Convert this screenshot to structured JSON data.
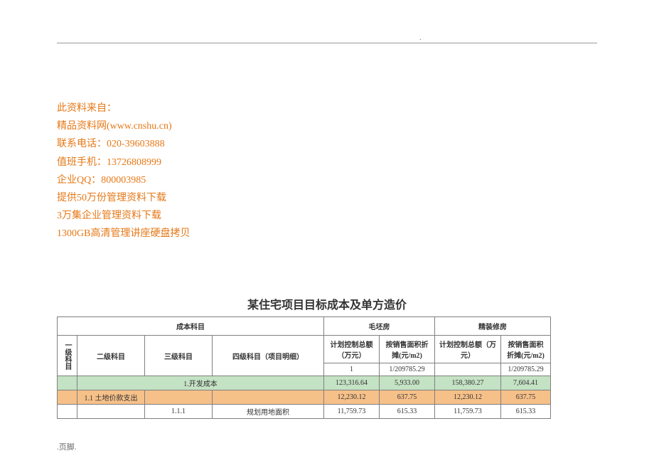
{
  "dot": ".",
  "source": {
    "line1": "此资料来自：",
    "line2": "精品资料网(www.cnshu.cn)",
    "line3": "联系电话：020-39603888",
    "line4": "值班手机：13726808999",
    "line5": "企业QQ：800003985",
    "line6": "提供50万份管理资料下载",
    "line7": "3万集企业管理资料下载",
    "line8": "1300GB高清管理讲座硬盘拷贝"
  },
  "title": "某住宅项目目标成本及单方造价",
  "headers": {
    "cost_subject": "成本科目",
    "rough_house": "毛坯房",
    "fine_house": "精装修房",
    "level1": "一级科目",
    "level2": "二级科目",
    "level3": "三级科目",
    "level4": "四级科目（项目明细）",
    "plan_total_rough": "计划控制总额（万元）",
    "per_area_rough": "按销售面积折摊(元/m2)",
    "plan_total_fine": "计划控制总额（万元）",
    "per_area_fine": "按销售面积折摊(元/m2)",
    "idx_rough_1": "1",
    "idx_rough_2": "1/209785.29",
    "idx_fine_1": "",
    "idx_fine_2": "1/209785.29"
  },
  "rows": {
    "r0": {
      "lvl1": "",
      "lvl2": "1.开发成本",
      "lvl2_span": "",
      "v1": "123,316.64",
      "v2": "5,933.00",
      "v3": "158,380.27",
      "v4": "7,604.41"
    },
    "r1": {
      "lvl1": "",
      "lvl2": "1.1 土地价款支出",
      "lvl3": "",
      "lvl4": "",
      "v1": "12,230.12",
      "v2": "637.75",
      "v3": "12,230.12",
      "v4": "637.75"
    },
    "r2": {
      "lvl1": "",
      "lvl2": "",
      "lvl3": "1.1.1",
      "lvl4": "规划用地面积",
      "v1": "11,759.73",
      "v2": "615.33",
      "v3": "11,759.73",
      "v4": "615.33"
    }
  },
  "footer": ".页脚."
}
